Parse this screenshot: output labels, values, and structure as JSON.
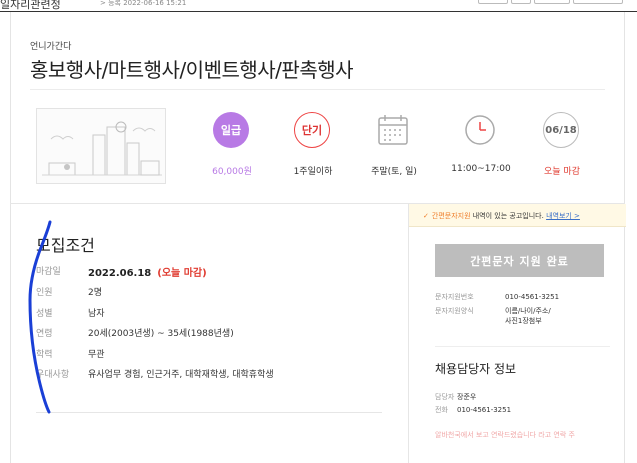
{
  "topbar": {
    "breadcrumb": "일자리관련정",
    "date_info": "> 등록 2022-06-16 15:21"
  },
  "job": {
    "company": "언니가간다",
    "title": "홍보행사/마트행사/이벤트행사/판촉행사"
  },
  "summary": [
    {
      "badge": "일급",
      "value": "60,000원",
      "icon": "pay-type-badge"
    },
    {
      "badge": "단기",
      "value": "1주일이하",
      "icon": "period-badge"
    },
    {
      "badge": "",
      "value": "주말(토, 일)",
      "icon": "calendar-icon"
    },
    {
      "badge": "",
      "value": "11:00~17:00",
      "icon": "clock-icon"
    },
    {
      "badge": "06/18",
      "value": "오늘 마감",
      "icon": "deadline-badge"
    }
  ],
  "requirements": {
    "title": "모집조건",
    "deadline": {
      "label": "마감일",
      "value": "2022.06.18",
      "note": "(오늘 마감)"
    },
    "rows": [
      {
        "label": "인원",
        "value": "2명"
      },
      {
        "label": "성별",
        "value": "남자"
      },
      {
        "label": "연령",
        "value": "20세(2003년생) ~ 35세(1988년생)"
      },
      {
        "label": "학력",
        "value": "무관"
      },
      {
        "label": "우대사항",
        "value": "유사업무 경험, 인근거주, 대학재학생, 대학휴학생"
      }
    ]
  },
  "sidebar": {
    "notice_check": "✓",
    "notice_highlight": "간편문자지원",
    "notice_text": " 내역이 있는 공고입니다.",
    "notice_link": "내역보기 >",
    "apply_button": "간편문자 지원 완료",
    "sms_number_label": "문자지원번호",
    "sms_number": "010-4561-3251",
    "sms_format_label": "문자지원양식",
    "sms_format_line1": "이름/나이/주소/",
    "sms_format_line2": "사진1장첨부",
    "contact_title": "채용담당자 정보",
    "manager_label": "담당자",
    "manager_name": "장준우",
    "phone_label": "전화",
    "phone": "010-4561-3251",
    "fade_text": "알바천국에서 보고 연락드렸습니다 라고 연락 주"
  },
  "colors": {
    "accent_orange": "#ef7e2b",
    "deadline_red": "#e03c31",
    "pay_purple": "#b87ae5",
    "pen_annotation": "#1a3fd6"
  }
}
